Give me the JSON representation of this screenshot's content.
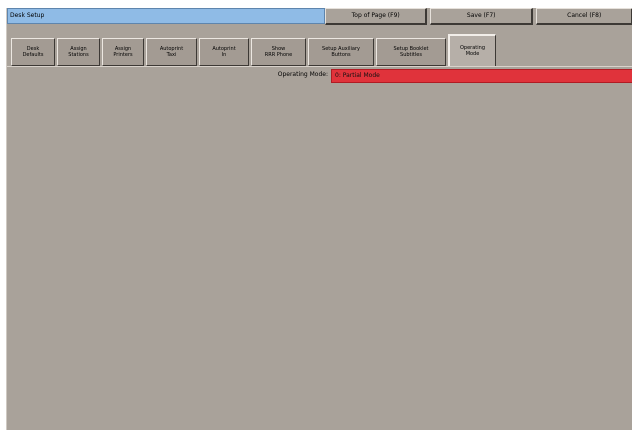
{
  "window": {
    "title": "Desk Setup",
    "buttons": {
      "top_of_page": "Top of Page (F9)",
      "save": "Save (F7)",
      "cancel": "Cancel (F8)"
    }
  },
  "tabs": [
    {
      "label": "Desk\nDefaults"
    },
    {
      "label": "Assign\nStations"
    },
    {
      "label": "Assign\nPrinters"
    },
    {
      "label": "Autoprint\nTaxi"
    },
    {
      "label": "Autoprint\nIn"
    },
    {
      "label": "Show\nRRR Phone"
    },
    {
      "label": "Setup Auxiliary\nButtons"
    },
    {
      "label": "Setup Booklet\nSubtitles"
    },
    {
      "label": "Operating\nMode"
    }
  ],
  "active_tab_index": 8,
  "operating_mode": {
    "label": "Operating Mode:",
    "value": "0: Partial Mode"
  },
  "colors": {
    "title_bg": "#8fbbe6",
    "panel_bg": "#a9a29a",
    "mode_value_bg": "#e0333b"
  }
}
